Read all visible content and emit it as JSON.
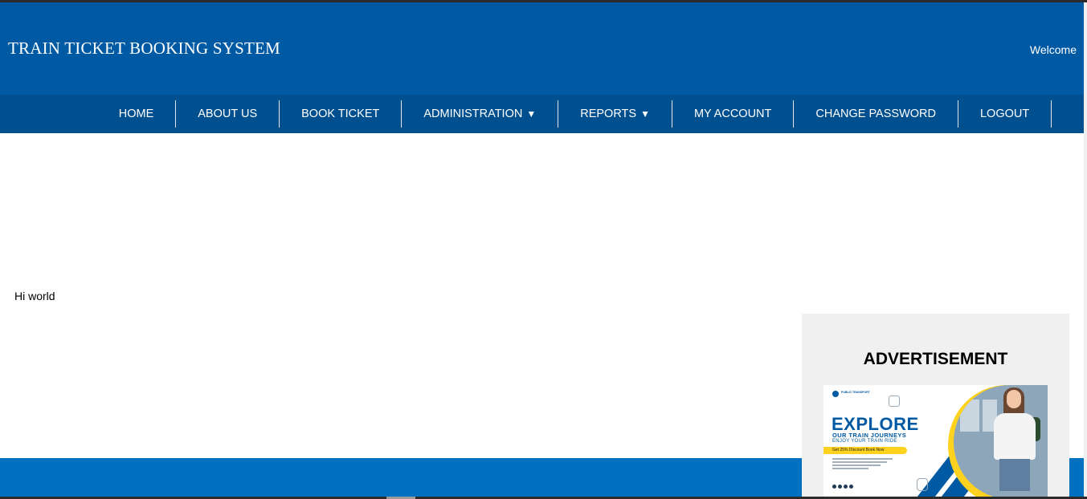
{
  "header": {
    "title": "TRAIN TICKET BOOKING SYSTEM",
    "welcome": "Welcome"
  },
  "nav": {
    "items": [
      {
        "label": "HOME"
      },
      {
        "label": "ABOUT US"
      },
      {
        "label": "BOOK TICKET"
      },
      {
        "label": "ADMINISTRATION",
        "arrow": "▼"
      },
      {
        "label": "REPORTS",
        "arrow": "▼"
      },
      {
        "label": "MY ACCOUNT"
      },
      {
        "label": "CHANGE PASSWORD"
      },
      {
        "label": "LOGOUT"
      }
    ]
  },
  "main": {
    "text": "Hi world"
  },
  "sidebar": {
    "ad_title": "ADVERTISEMENT",
    "banner": {
      "logo_text": "PUBLIC TRANSPORT",
      "headline": "EXPLORE",
      "subheadline": "OUR TRAIN JOURNEYS",
      "tagline": "ENJOY YOUR TRAIN RIDE",
      "offer": "Get 25% Discount Book Now",
      "colors": {
        "brand": "#005aa3",
        "accent": "#ffd21f"
      }
    }
  },
  "colors": {
    "header_bg": "#005aa3",
    "nav_bg": "#004f8e",
    "footer_bg": "#0070c0",
    "ad_box_bg": "#f0f0f0"
  }
}
